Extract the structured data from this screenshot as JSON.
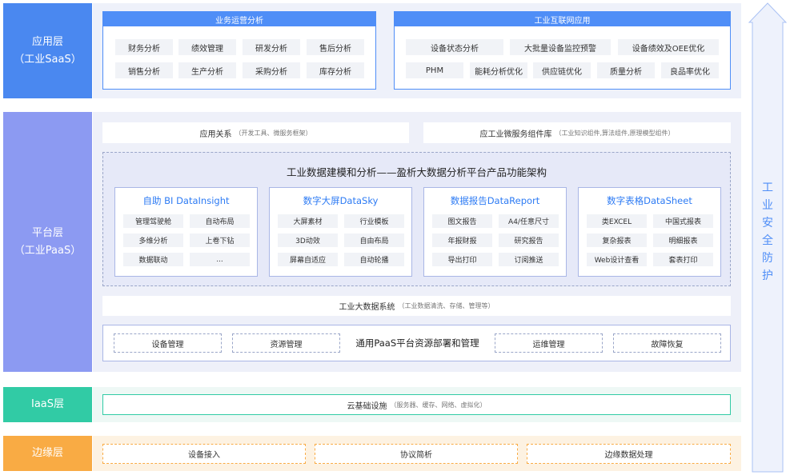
{
  "layers": {
    "app": {
      "name": "应用层",
      "sub": "（工业SaaS）"
    },
    "platform": {
      "name": "平台层",
      "sub": "（工业PaaS）"
    },
    "iaas": {
      "name": "IaaS层"
    },
    "edge": {
      "name": "边缘层"
    }
  },
  "app_layer": {
    "business": {
      "title": "业务运营分析",
      "items": [
        "财务分析",
        "绩效管理",
        "研发分析",
        "售后分析",
        "销售分析",
        "生产分析",
        "采购分析",
        "库存分析"
      ]
    },
    "industrial": {
      "title": "工业互联网应用",
      "row1": [
        "设备状态分析",
        "大批量设备监控预警",
        "设备绩效及OEE优化"
      ],
      "row2": [
        "PHM",
        "能耗分析优化",
        "供应链优化",
        "质量分析",
        "良品率优化"
      ]
    }
  },
  "platform_layer": {
    "app_relation": {
      "label": "应用关系",
      "note": "（开发工具、微服务框架）"
    },
    "micro_service": {
      "label": "应工业微服务组件库",
      "note": "（工业知识组件,算法组件,原理模型组件）"
    },
    "architecture_title": "工业数据建模和分析——盈析大数据分析平台产品功能架构",
    "products": [
      {
        "title": "自助 BI DataInsight",
        "items": [
          "管理驾驶舱",
          "自动布局",
          "多维分析",
          "上卷下钻",
          "数据联动",
          "..."
        ]
      },
      {
        "title": "数字大屏DataSky",
        "items": [
          "大屏素材",
          "行业模板",
          "3D动效",
          "自由布局",
          "屏幕自适应",
          "自动轮播"
        ]
      },
      {
        "title": "数据报告DataReport",
        "items": [
          "图文报告",
          "A4/任意尺寸",
          "年报财报",
          "研究报告",
          "导出打印",
          "订阅推送"
        ]
      },
      {
        "title": "数字表格DataSheet",
        "items": [
          "类EXCEL",
          "中国式报表",
          "复杂报表",
          "明细报表",
          "Web设计查看",
          "套表打印"
        ]
      }
    ],
    "big_data": {
      "label": "工业大数据系统",
      "note": "（工业数据清洗、存储、管理等）"
    },
    "paas": {
      "center": "通用PaaS平台资源部署和管理",
      "items": [
        "设备管理",
        "资源管理",
        "运维管理",
        "故障恢复"
      ]
    }
  },
  "iaas_layer": {
    "label": "云基础设施",
    "note": "（服务器、缓存、网络、虚拟化）"
  },
  "edge_layer": {
    "items": [
      "设备接入",
      "协议简析",
      "边缘数据处理"
    ]
  },
  "security": {
    "chars": [
      "工",
      "业",
      "安",
      "全",
      "防",
      "护"
    ]
  },
  "colors": {
    "app": "#4a88f0",
    "platform": "#8c9af2",
    "iaas": "#31cba5",
    "edge": "#f9ab44",
    "header": "#4f8ef7",
    "accent_text": "#2d7bf4"
  }
}
